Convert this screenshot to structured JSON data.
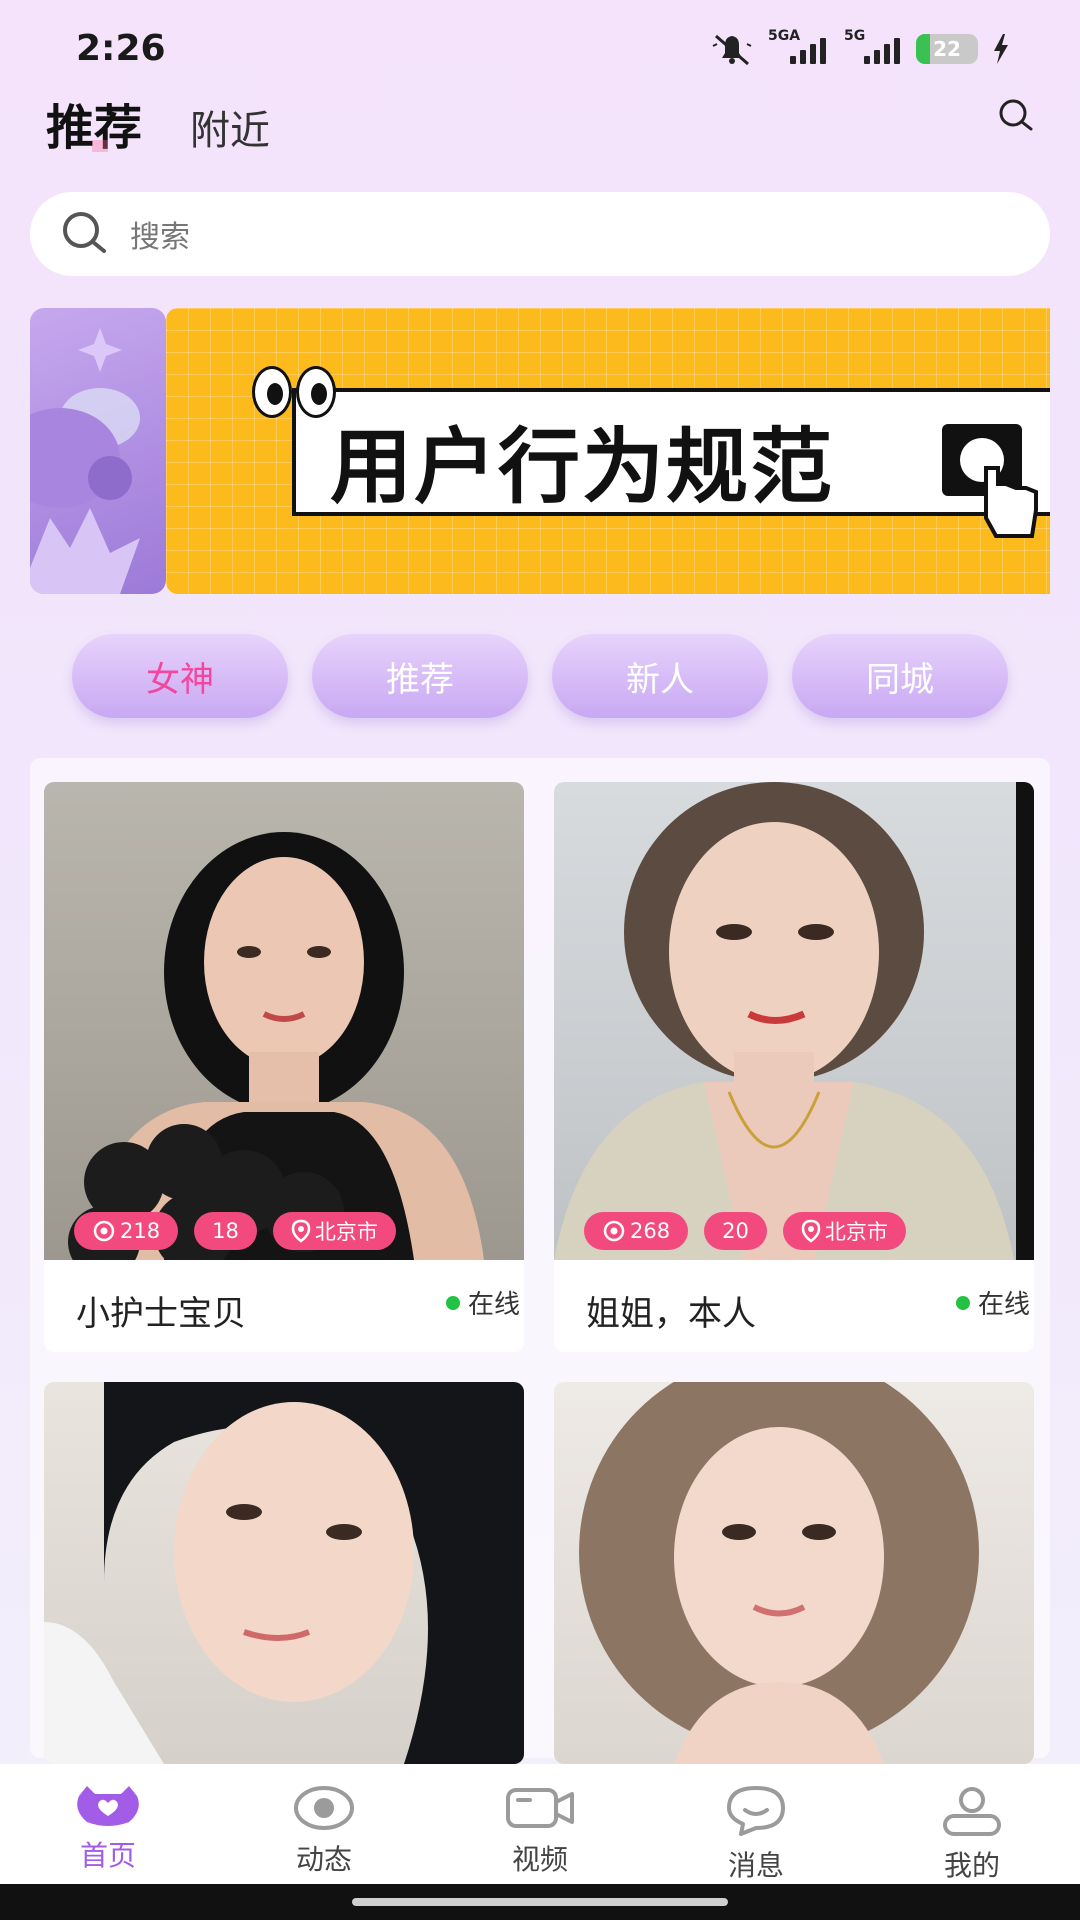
{
  "status_bar": {
    "time": "2:26",
    "network_1": "5GA",
    "network_2": "5G",
    "battery_level": "22",
    "battery_fraction": 0.22,
    "icons": [
      "mute-bell-icon",
      "signal-icon",
      "signal-icon",
      "battery-icon",
      "charging-bolt-icon"
    ]
  },
  "top_tabs": {
    "active": "推荐",
    "other": "附近"
  },
  "search": {
    "placeholder": "搜索"
  },
  "banner": {
    "text": "用户行为规范"
  },
  "categories": [
    "女神",
    "推荐",
    "新人",
    "同城"
  ],
  "cards": [
    {
      "views": "218",
      "age": "18",
      "city": "北京市",
      "name": "小护士宝贝",
      "status": "在线"
    },
    {
      "views": "268",
      "age": "20",
      "city": "北京市",
      "name": "姐姐，本人",
      "status": "在线"
    },
    {
      "views": "",
      "age": "",
      "city": "",
      "name": "",
      "status": ""
    },
    {
      "views": "",
      "age": "",
      "city": "",
      "name": "",
      "status": ""
    }
  ],
  "bottom_nav": [
    {
      "label": "首页",
      "icon": "home-heart-icon",
      "active": true
    },
    {
      "label": "动态",
      "icon": "eye-icon",
      "active": false
    },
    {
      "label": "视频",
      "icon": "video-camera-icon",
      "active": false
    },
    {
      "label": "消息",
      "icon": "chat-bubble-icon",
      "active": false
    },
    {
      "label": "我的",
      "icon": "user-icon",
      "active": false
    }
  ],
  "colors": {
    "accent_pink": "#f3479f",
    "badge_pink": "#f24a7f",
    "nav_active": "#a35ce8",
    "banner_yellow": "#fdba1c",
    "online_green": "#23c245"
  }
}
